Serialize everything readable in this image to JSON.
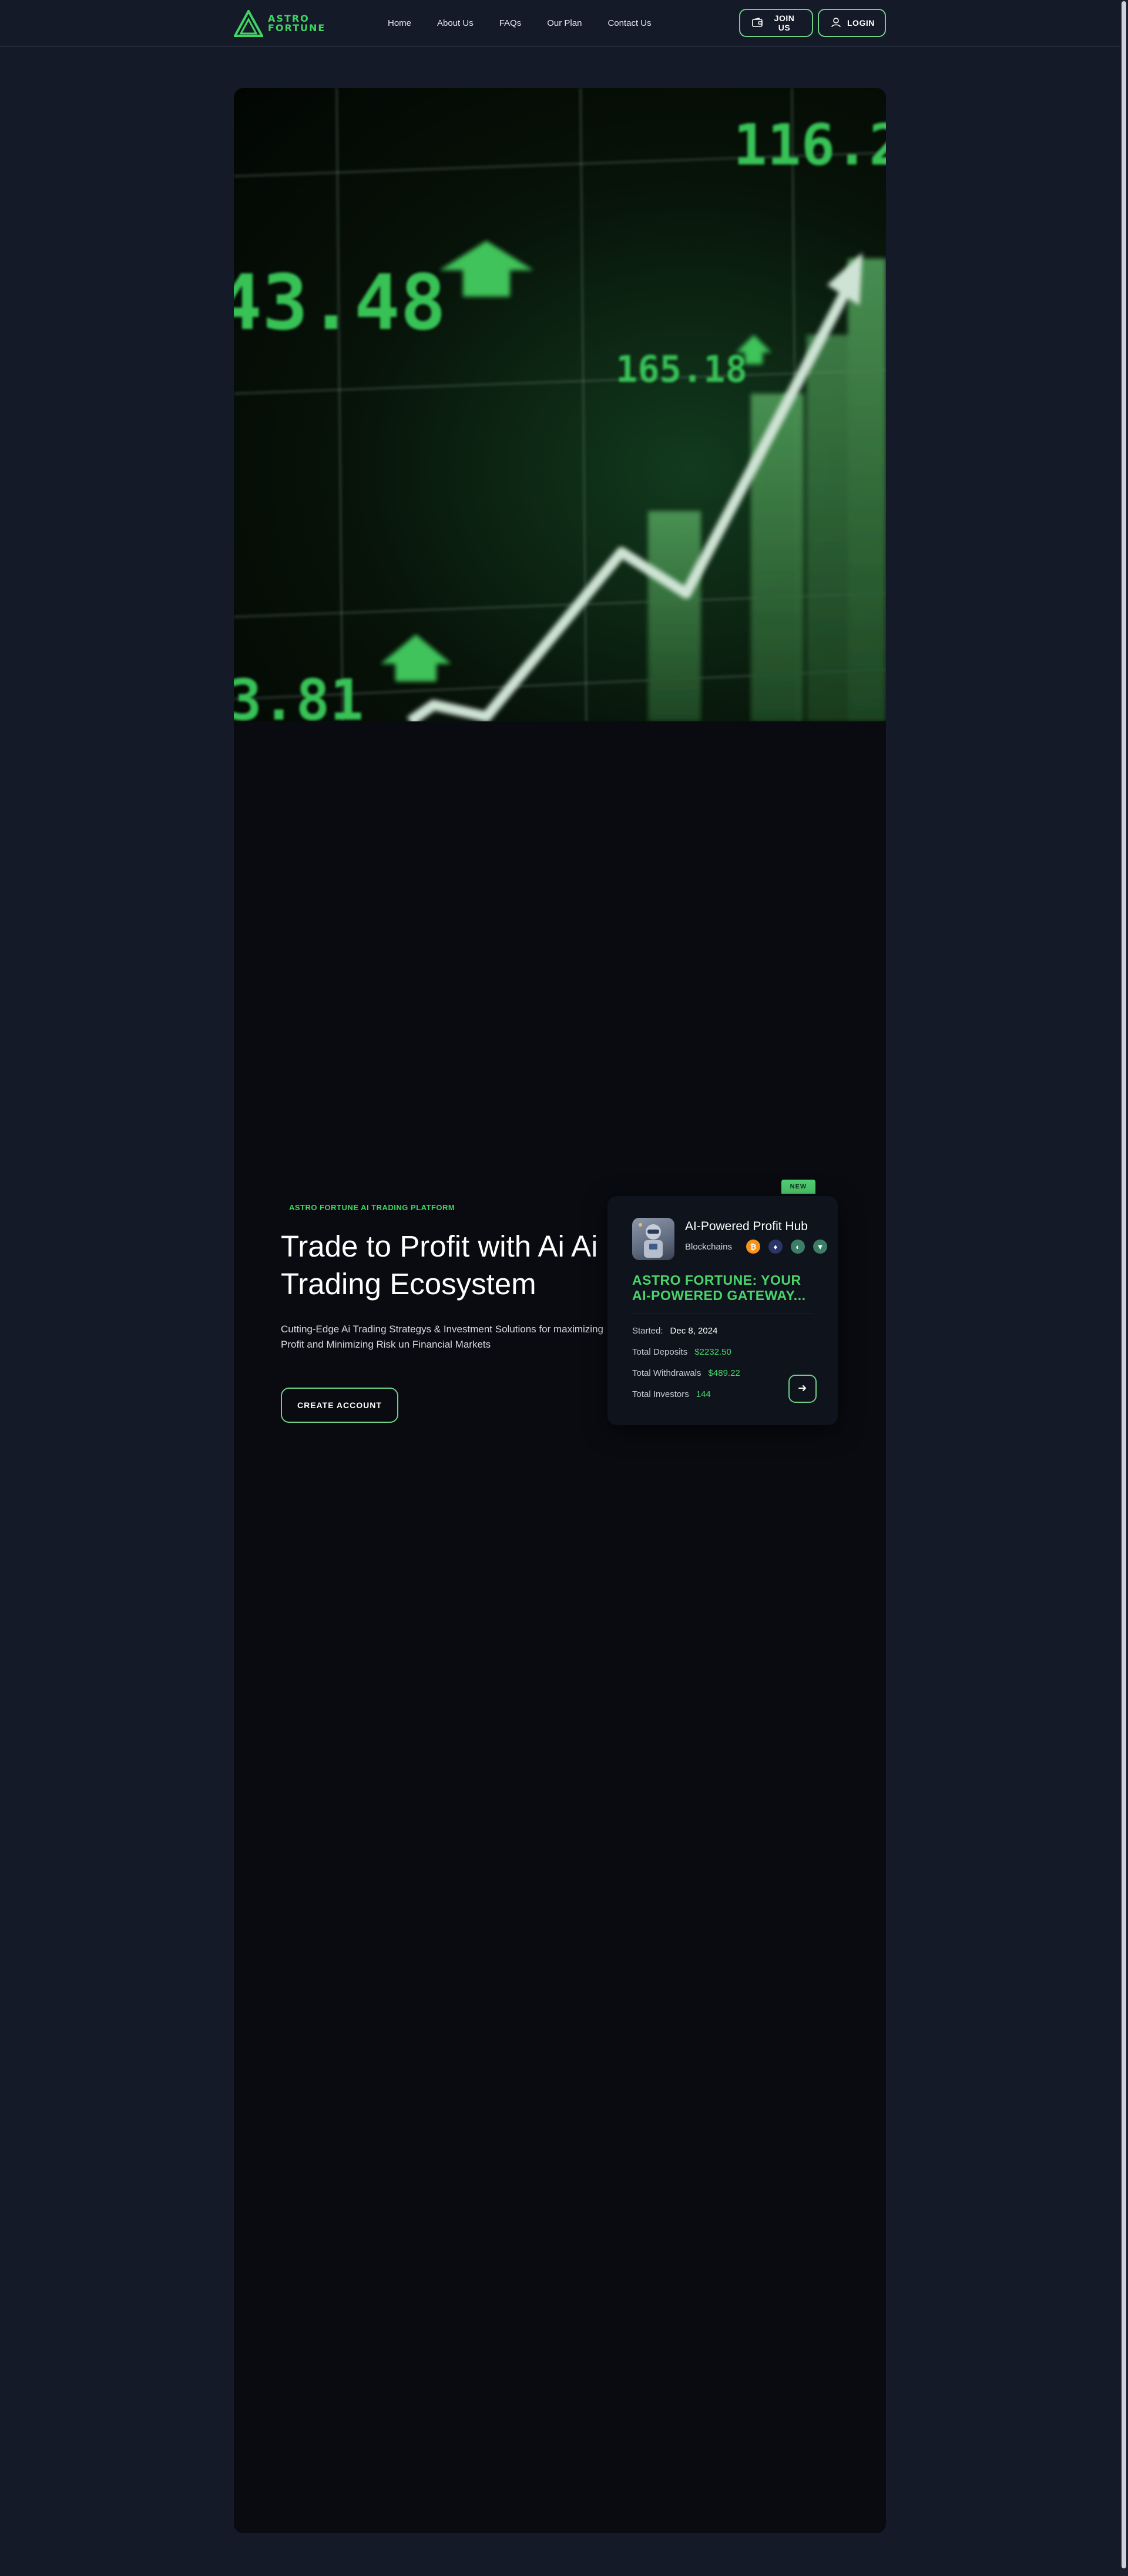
{
  "header": {
    "logo_line1": "ASTRO",
    "logo_line2": "FORTUNE",
    "nav": [
      "Home",
      "About Us",
      "FAQs",
      "Our Plan",
      "Contact Us"
    ],
    "join_label": "JOIN US",
    "login_label": "LOGIN"
  },
  "hero_image": {
    "numbers": [
      "116.2",
      "43.48",
      "165.18",
      "3.81"
    ]
  },
  "hero": {
    "eyebrow": "ASTRO FORTUNE AI TRADING PLATFORM",
    "title": "Trade to Profit with Ai Ai Trading Ecosystem",
    "subtitle": "Cutting-Edge Ai Trading Strategys & Investment Solutions for maximizing Profit and Minimizing Risk un Financial Markets",
    "cta_label": "CREATE ACCOUNT"
  },
  "plan_card": {
    "badge": "NEW",
    "title": "AI-Powered Profit Hub",
    "blockchains_label": "Blockchains",
    "blockchains": [
      {
        "name": "bitcoin-icon",
        "glyph": "₿",
        "color": "#f7931a"
      },
      {
        "name": "ethereum-icon",
        "glyph": "♦",
        "color": "#4c5ba8"
      },
      {
        "name": "chain-3-icon",
        "glyph": "◐",
        "color": "#6ecf87"
      },
      {
        "name": "chain-4-icon",
        "glyph": "▼",
        "color": "#6ecf87"
      }
    ],
    "headline": "ASTRO FORTUNE: YOUR AI-POWERED GATEWAY...",
    "started_label": "Started:",
    "started_value": "Dec 8, 2024",
    "deposits_label": "Total Deposits",
    "deposits_value": "$2232.50",
    "withdrawals_label": "Total Withdrawals",
    "withdrawals_value": "$489.22",
    "investors_label": "Total Investors",
    "investors_value": "144"
  },
  "colors": {
    "accent": "#3fd463",
    "background": "#141a28",
    "panel": "#090b10"
  }
}
